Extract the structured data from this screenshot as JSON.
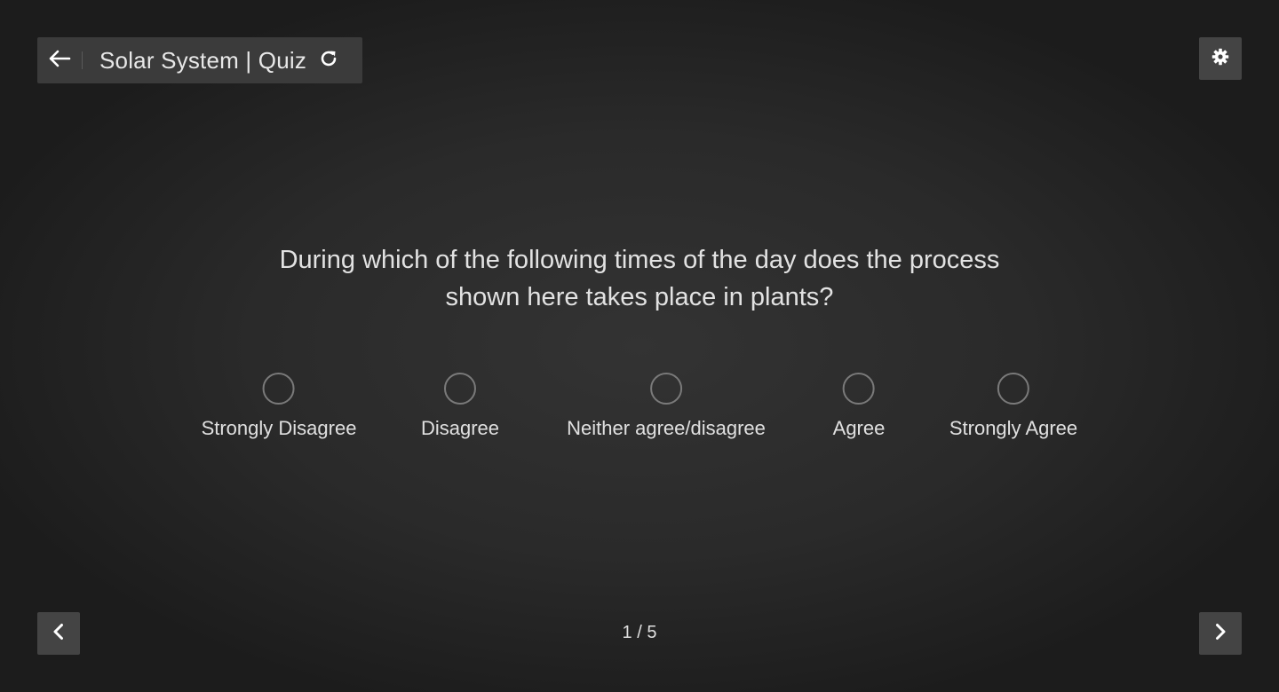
{
  "header": {
    "title": "Solar System | Quiz",
    "back_icon": "arrow-left-icon",
    "reload_icon": "reload-icon",
    "settings_icon": "gear-icon"
  },
  "question": {
    "text": "During which of the following times of the day does the process shown here takes place in plants?"
  },
  "options": [
    {
      "label": "Strongly Disagree",
      "selected": false
    },
    {
      "label": "Disagree",
      "selected": false
    },
    {
      "label": "Neither agree/disagree",
      "selected": false
    },
    {
      "label": "Agree",
      "selected": false
    },
    {
      "label": "Strongly Agree",
      "selected": false
    }
  ],
  "pagination": {
    "indicator": "1 / 5",
    "prev_icon": "chevron-left-icon",
    "next_icon": "chevron-right-icon"
  },
  "colors": {
    "background": "#2a2a2a",
    "button": "#444444",
    "title_bar": "#3b3b3b",
    "radio_border": "#7a7a7a",
    "text": "#e2e2e2"
  }
}
